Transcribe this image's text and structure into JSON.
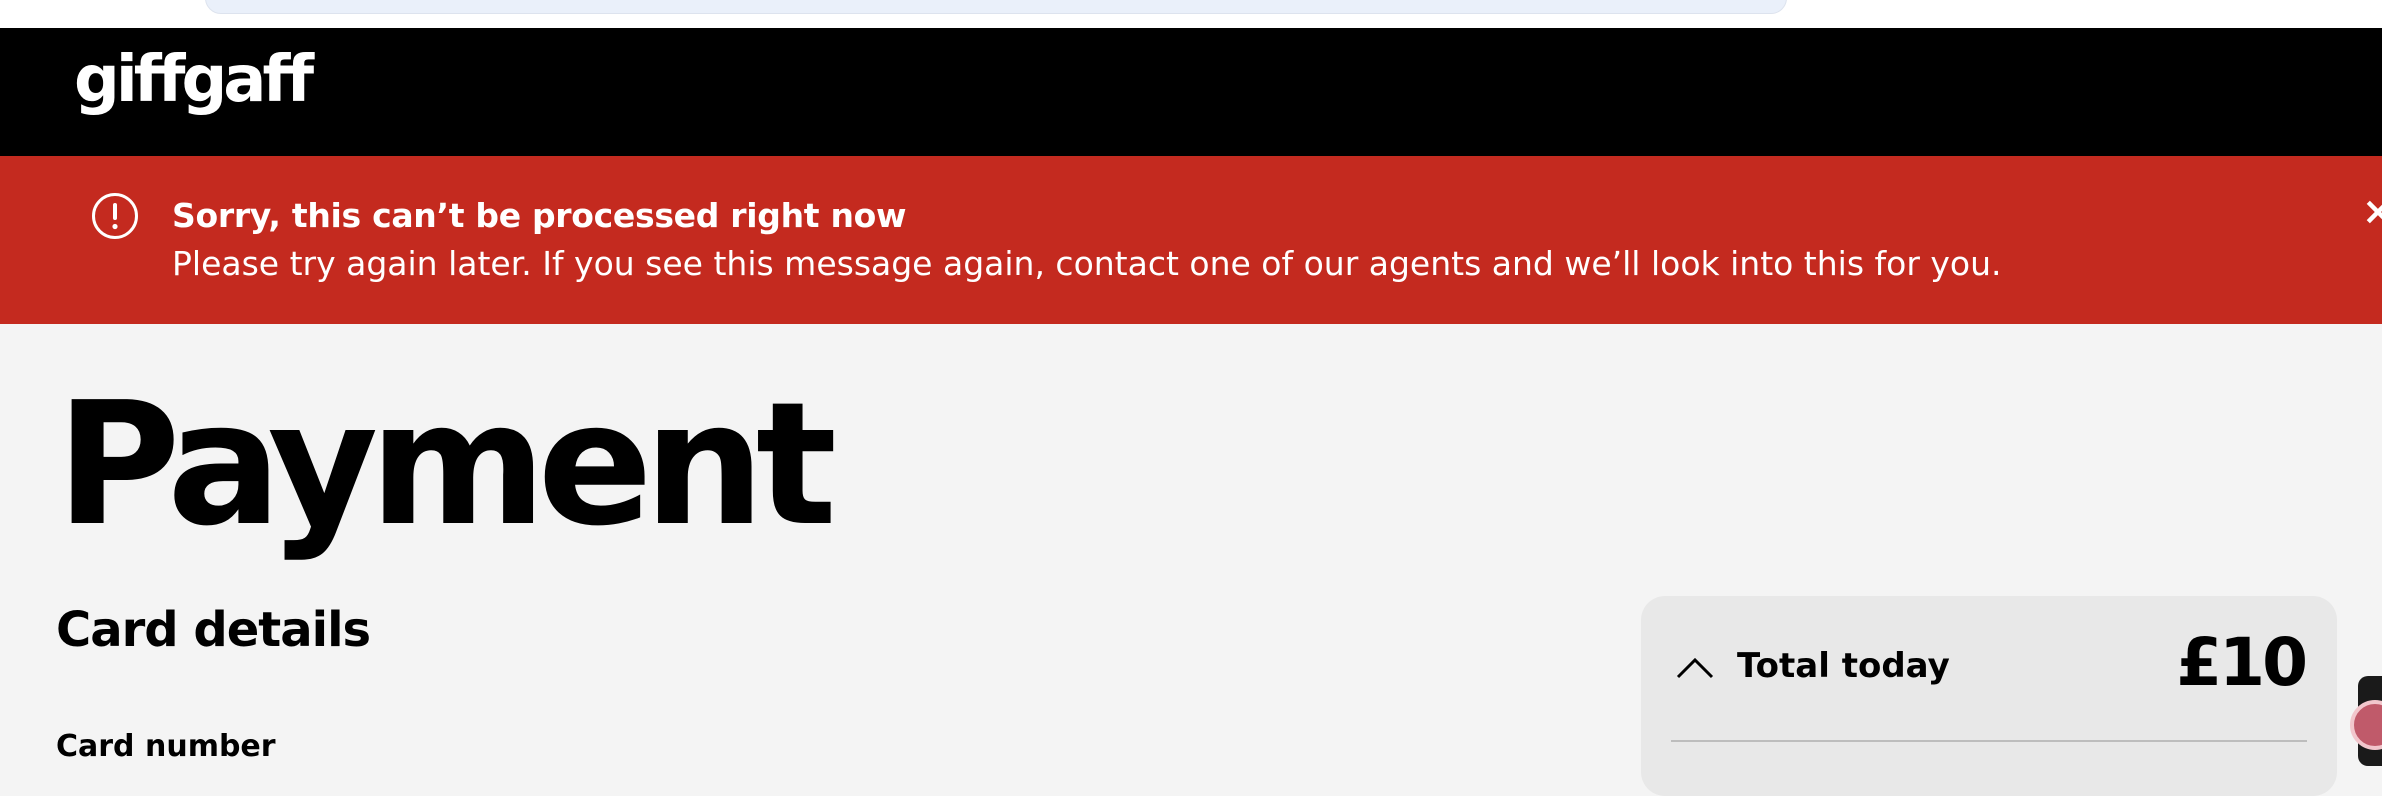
{
  "brand": {
    "logo_text": "giffgaff"
  },
  "error_banner": {
    "title": "Sorry, this can’t be processed right now",
    "message": "Please try again later. If you see this message again, contact one of our agents and we’ll look into this for you.",
    "close_label": "×",
    "icon": "alert-circle-icon",
    "background_color": "#c42a1f"
  },
  "page": {
    "title": "Payment",
    "section_heading": "Card details",
    "card_number_label": "Card number"
  },
  "summary": {
    "label": "Total today",
    "amount": "£10",
    "toggle_icon": "chevron-up-icon"
  },
  "colors": {
    "header_bg": "#000000",
    "page_bg": "#f4f4f4",
    "summary_bg": "#e8e8e8"
  }
}
